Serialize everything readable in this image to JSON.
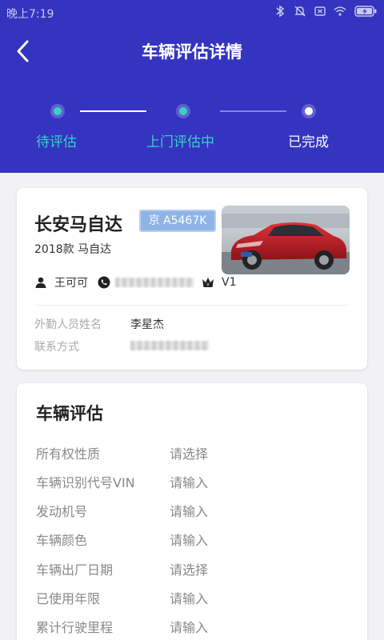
{
  "status_bar": {
    "time": "晚上7:19",
    "icons": [
      "bluetooth-icon",
      "alarm-off-icon",
      "sim-off-icon",
      "wifi-icon",
      "battery-charging-icon"
    ]
  },
  "header": {
    "title": "车辆评估详情",
    "back_icon": "chevron-left-icon"
  },
  "steps": [
    {
      "label": "待评估",
      "state": "active"
    },
    {
      "label": "上门评估中",
      "state": "active"
    },
    {
      "label": "已完成",
      "state": "done"
    }
  ],
  "vehicle_card": {
    "name": "长安马自达",
    "plate": "京 A5467K",
    "model": "2018款 马自达",
    "owner": "王可可",
    "phone": "",
    "level": "V1",
    "field_staff_label": "外勤人员姓名",
    "field_staff_value": "李星杰",
    "contact_label": "联系方式",
    "contact_value": ""
  },
  "assessment": {
    "title": "车辆评估",
    "rows": [
      {
        "label": "所有权性质",
        "value": "请选择"
      },
      {
        "label": "车辆识别代号VIN",
        "value": "请输入"
      },
      {
        "label": "发动机号",
        "value": "请输入"
      },
      {
        "label": "车辆颜色",
        "value": "请输入"
      },
      {
        "label": "车辆出厂日期",
        "value": "请选择"
      },
      {
        "label": "已使用年限",
        "value": "请输入"
      },
      {
        "label": "累计行驶里程",
        "value": "请输入"
      }
    ]
  },
  "colors": {
    "header_bg": "#3434c0",
    "accent_teal": "#37d3c4",
    "plate_bg": "#8fb4e6"
  }
}
